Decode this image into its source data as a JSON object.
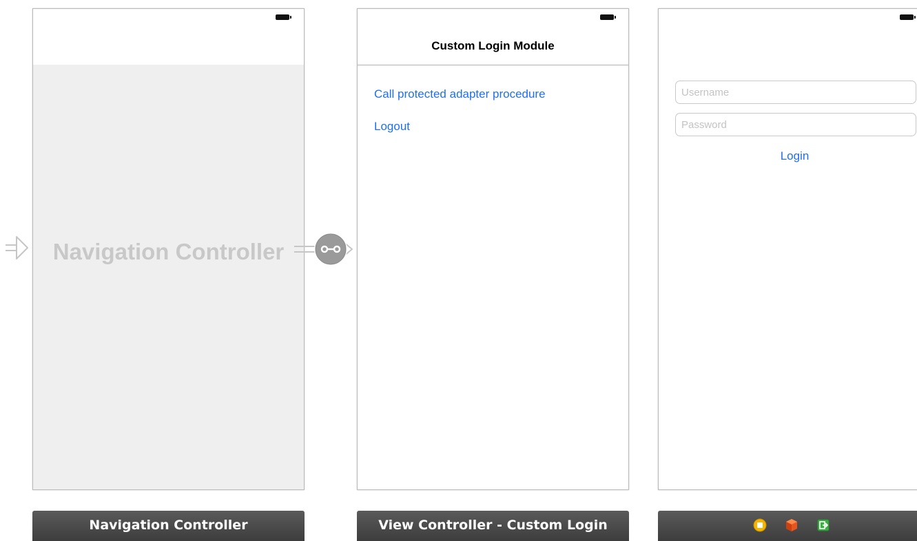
{
  "scenes": {
    "navigation": {
      "placeholder": "Navigation Controller",
      "label": "Navigation Controller"
    },
    "view_controller": {
      "nav_title": "Custom Login Module",
      "links": [
        "Call protected adapter procedure",
        "Logout"
      ],
      "label": "View Controller - Custom Login"
    },
    "login": {
      "username": {
        "value": "",
        "placeholder": "Username"
      },
      "password": {
        "value": "",
        "placeholder": "Password"
      },
      "login_button": "Login",
      "dock_icons": [
        "first-responder-icon",
        "object-cube-icon",
        "exit-icon"
      ]
    }
  },
  "colors": {
    "link_blue": "#1f6ff0",
    "label_bar": "#4a4a4a",
    "placeholder_gray": "#c8c8c8",
    "nav_body": "#efefef",
    "segue_gray": "#9a9a9a"
  },
  "icons": {
    "entry_point": "entry-arrow-icon",
    "segue": "segue-link-icon",
    "battery": "battery-icon"
  }
}
